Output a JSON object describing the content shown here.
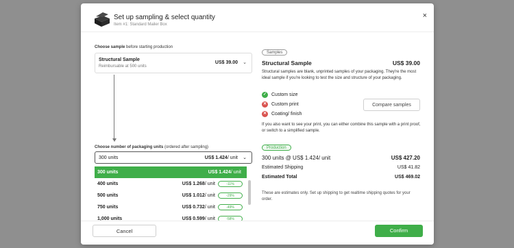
{
  "header": {
    "title": "Set up sampling & select quantity",
    "subtitle": "Item #1: Standard Mailer Box",
    "close_icon": "×"
  },
  "left": {
    "sample_label_bold": "Choose sample",
    "sample_label_rest": " before starting production",
    "sample_select": {
      "name": "Structural Sample",
      "sub": "Reimbursable at 500 units",
      "price": "US$ 39.00",
      "chevron": "⌄"
    },
    "qty_label_bold": "Choose number of packaging units",
    "qty_label_rest": " (ordered after sampling)",
    "qty_select": {
      "units": "300 units",
      "price_bold": "US$ 1.424",
      "price_rest": "/ unit",
      "chevron": "⌄"
    },
    "options": [
      {
        "units": "300 units",
        "price_bold": "US$ 1.424",
        "price_rest": "/ unit",
        "badge": "",
        "selected": true
      },
      {
        "units": "400 units",
        "price_bold": "US$ 1.268",
        "price_rest": "/ unit",
        "badge": "-11%",
        "selected": false
      },
      {
        "units": "500 units",
        "price_bold": "US$ 1.012",
        "price_rest": "/ unit",
        "badge": "-29%",
        "selected": false
      },
      {
        "units": "750 units",
        "price_bold": "US$ 0.732",
        "price_rest": "/ unit",
        "badge": "-49%",
        "selected": false
      },
      {
        "units": "1,000 units",
        "price_bold": "US$ 0.599",
        "price_rest": "/ unit",
        "badge": "-58%",
        "selected": false
      }
    ]
  },
  "right": {
    "samples_pill": "Samples",
    "sample_title": "Structural Sample",
    "sample_price": "US$ 39.00",
    "description": "Structural samples are blank, unprinted samples of your packaging. They're the most ideal sample if you're looking to test the size and structure of your packaging.",
    "features": [
      {
        "label": "Custom size",
        "ok": true
      },
      {
        "label": "Custom print",
        "ok": false
      },
      {
        "label": "Coating/ finish",
        "ok": false
      }
    ],
    "compare_label": "Compare samples",
    "note": "If you also want to see your print, you can either combine this sample with a print proof, or switch to a simplified sample.",
    "production_pill": "Production",
    "production_line": "300 units @ US$ 1.424/ unit",
    "production_total": "US$ 427.20",
    "shipping_label": "Estimated Shipping",
    "shipping_value": "US$ 41.82",
    "total_label": "Estimated Total",
    "total_value": "US$ 469.02",
    "estimate_note": "These are estimates only. Set up shipping to get realtime shipping quotes for your order."
  },
  "footer": {
    "cancel_label": "Cancel",
    "confirm_label": "Confirm"
  },
  "colors": {
    "accent": "#3fae49",
    "error": "#d9534f"
  }
}
